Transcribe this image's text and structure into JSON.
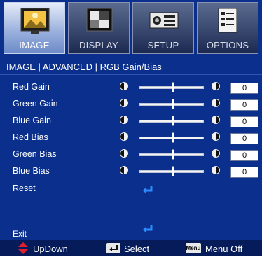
{
  "tabs": [
    {
      "label": "IMAGE",
      "icon": "image-icon",
      "active": true
    },
    {
      "label": "DISPLAY",
      "icon": "display-icon",
      "active": false
    },
    {
      "label": "SETUP",
      "icon": "setup-icon",
      "active": false
    },
    {
      "label": "OPTIONS",
      "icon": "options-icon",
      "active": false
    }
  ],
  "breadcrumb": "IMAGE | ADVANCED | RGB Gain/Bias",
  "settings": [
    {
      "label": "Red Gain",
      "value": "0"
    },
    {
      "label": "Green Gain",
      "value": "0"
    },
    {
      "label": "Blue Gain",
      "value": "0"
    },
    {
      "label": "Red Bias",
      "value": "0"
    },
    {
      "label": "Green Bias",
      "value": "0"
    },
    {
      "label": "Blue Bias",
      "value": "0"
    }
  ],
  "reset_label": "Reset",
  "exit_label": "Exit",
  "footer": {
    "updown_label": "UpDown",
    "select_label": "Select",
    "menu_key_label": "Menu",
    "menu_off_label": "Menu Off"
  },
  "colors": {
    "background": "#0a2f8c",
    "accent_enter": "#2a8cff",
    "updown_arrow": "#e0202f"
  }
}
